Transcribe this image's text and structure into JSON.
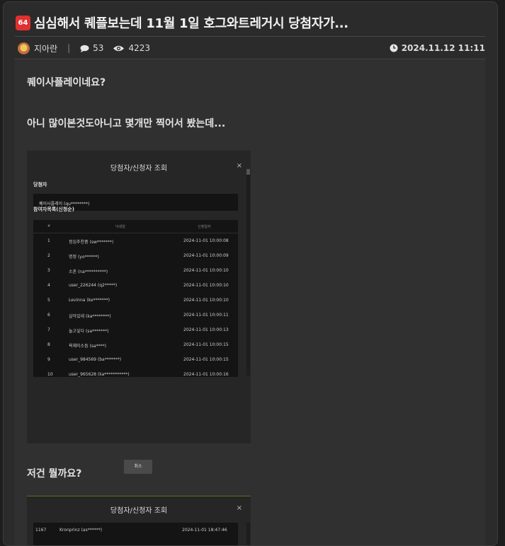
{
  "post": {
    "badge": "64",
    "title": "심심해서 퀘플보는데 11월 1일 호그와트레거시 당첨자가...",
    "author": "지아란",
    "separator": "|",
    "comment_count": "53",
    "view_count": "4223",
    "date": "2024.11.12 11:11"
  },
  "content": {
    "p1": "퀘이사플레이네요?",
    "p2": "아니 많이본것도아니고 몇개만 찍어서 봤는데...",
    "p3": "저건 뭘까요?"
  },
  "screenshot1": {
    "title": "당첨자/신청자 조회",
    "close": "×",
    "winner_label": "당첨자",
    "winner_value": "퀘이사플레이 (qu********)",
    "participants_label": "참여자목록(신청순)",
    "columns": [
      "#",
      "닉네임",
      "신청일자"
    ],
    "rows": [
      {
        "num": "1",
        "nick": "정심추천좀 (sw*******)",
        "time": "2024-11-01 10:00:08"
      },
      {
        "num": "2",
        "nick": "명정 (yo******)",
        "time": "2024-11-01 10:00:09"
      },
      {
        "num": "3",
        "nick": "소혼 (na**********)",
        "time": "2024-11-01 10:00:10"
      },
      {
        "num": "4",
        "nick": "user_226244 (q2*****)",
        "time": "2024-11-01 10:00:10"
      },
      {
        "num": "5",
        "nick": "Levinna (ke*******)",
        "time": "2024-11-01 10:00:10"
      },
      {
        "num": "6",
        "nick": "살아있네 (ka********)",
        "time": "2024-11-01 10:00:11"
      },
      {
        "num": "7",
        "nick": "놀고싶다 (sa*******)",
        "time": "2024-11-01 10:00:13"
      },
      {
        "num": "8",
        "nick": "욕체미소듬 (sa****)",
        "time": "2024-11-01 10:00:15"
      },
      {
        "num": "9",
        "nick": "user_984569 (ba*******)",
        "time": "2024-11-01 10:00:15"
      },
      {
        "num": "10",
        "nick": "user_965628 (ka***********)",
        "time": "2024-11-01 10:00:16"
      }
    ],
    "cancel": "취소"
  },
  "screenshot2": {
    "title": "당첨자/신청자 조회",
    "close": "×",
    "row": {
      "num": "1167",
      "nick": "Kronprinz (as******)",
      "time": "2024-11-01 18:47:46"
    }
  }
}
